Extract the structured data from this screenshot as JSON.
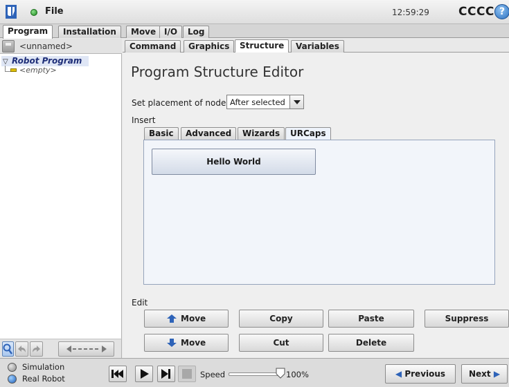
{
  "header": {
    "file_label": "File",
    "clock": "12:59:29",
    "robot_name": "CCCC",
    "help_symbol": "?",
    "logo_text": "UR",
    "brand_color": "#2e63b8",
    "run_status_color": "#1f8a1f"
  },
  "main_tabs": [
    "Program",
    "Installation",
    "Move",
    "I/O",
    "Log"
  ],
  "main_tabs_active": "Program",
  "left_panel": {
    "program_name": "<unnamed>",
    "tree": {
      "root": "Robot Program",
      "child": "<empty>"
    }
  },
  "sub_tabs": [
    "Command",
    "Graphics",
    "Structure",
    "Variables"
  ],
  "sub_tabs_active": "Structure",
  "editor": {
    "title": "Program Structure Editor",
    "placement_label": "Set placement of node",
    "placement_value": "After selected",
    "insert_label": "Insert",
    "insert_tabs": [
      "Basic",
      "Advanced",
      "Wizards",
      "URCaps"
    ],
    "insert_tabs_active": "URCaps",
    "urcap_buttons": [
      "Hello World"
    ],
    "edit_label": "Edit",
    "edit_buttons": {
      "move_up": "Move",
      "move_down": "Move",
      "copy": "Copy",
      "cut": "Cut",
      "paste": "Paste",
      "delete": "Delete",
      "suppress": "Suppress"
    }
  },
  "footer": {
    "mode_simulation": "Simulation",
    "mode_real_robot": "Real Robot",
    "speed_label": "Speed",
    "speed_value": "100%",
    "speed_fraction": 1.0,
    "previous_label": "Previous",
    "next_label": "Next",
    "icons": [
      "rewind-icon",
      "play-icon",
      "step-icon",
      "stop-icon"
    ]
  }
}
